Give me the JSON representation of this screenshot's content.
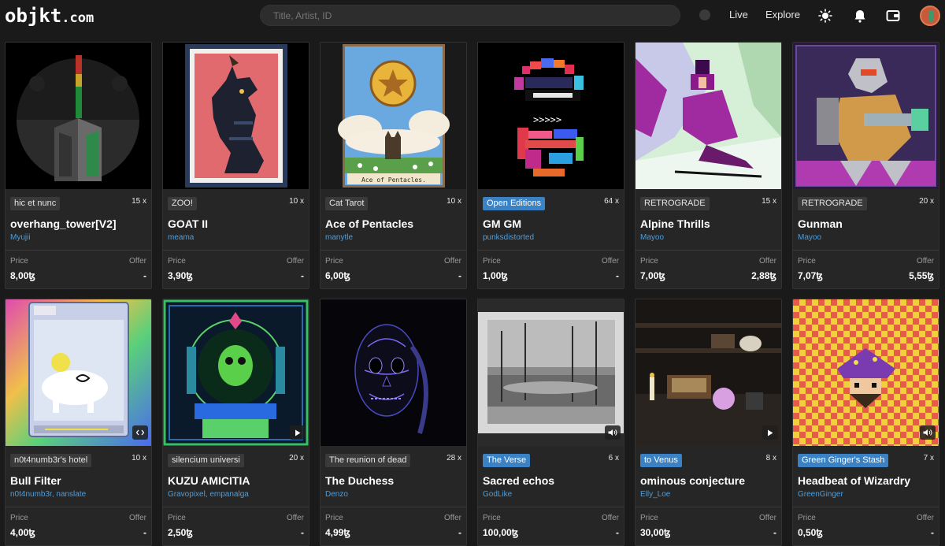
{
  "header": {
    "logo_main": "objkt",
    "logo_dom": ".com",
    "search_placeholder": "Title, Artist, ID",
    "nav_live": "Live",
    "nav_explore": "Explore",
    "icons": [
      "theme-sun-icon",
      "bell-icon",
      "wallet-icon",
      "avatar"
    ]
  },
  "labels": {
    "price": "Price",
    "offer": "Offer"
  },
  "colors": {
    "accent_blue": "#3b82c4",
    "artist_link": "#4a9fe0",
    "background": "#1a1a1a",
    "card": "#262626"
  },
  "cards": [
    {
      "badge": "hic et nunc",
      "badge_blue": false,
      "count": "15 x",
      "title": "overhang_tower[V2]",
      "artist": "Myujii",
      "price": "8,00ꜩ",
      "offer": "-"
    },
    {
      "badge": "ZOO!",
      "badge_blue": false,
      "count": "10 x",
      "title": "GOAT II",
      "artist": "meama",
      "price": "3,90ꜩ",
      "offer": "-"
    },
    {
      "badge": "Cat Tarot",
      "badge_blue": false,
      "count": "10 x",
      "title": "Ace of Pentacles",
      "artist": "manytle",
      "price": "6,00ꜩ",
      "offer": "-"
    },
    {
      "badge": "Open Editions",
      "badge_blue": true,
      "count": "64 x",
      "title": "GM GM",
      "artist": "punksdistorted",
      "price": "1,00ꜩ",
      "offer": "-"
    },
    {
      "badge": "RETROGRADE",
      "badge_blue": false,
      "count": "15 x",
      "title": "Alpine Thrills",
      "artist": "Mayoo",
      "price": "7,00ꜩ",
      "offer": "2,88ꜩ"
    },
    {
      "badge": "RETROGRADE",
      "badge_blue": false,
      "count": "20 x",
      "title": "Gunman",
      "artist": "Mayoo",
      "price": "7,07ꜩ",
      "offer": "5,55ꜩ"
    },
    {
      "badge": "n0t4numb3r's hotel",
      "badge_blue": false,
      "count": "10 x",
      "title": "Bull Filter",
      "artist": "n0t4numb3r, nanslate",
      "price": "4,00ꜩ",
      "offer": "-",
      "media": "code-icon"
    },
    {
      "badge": "silencium universi",
      "badge_blue": false,
      "count": "20 x",
      "title": "KUZU AMICITIA",
      "artist": "Gravopixel, empanalga",
      "price": "2,50ꜩ",
      "offer": "-",
      "media": "play-icon"
    },
    {
      "badge": "The reunion of dead",
      "badge_blue": false,
      "count": "28 x",
      "title": "The Duchess",
      "artist": "Denzo",
      "price": "4,99ꜩ",
      "offer": "-"
    },
    {
      "badge": "The Verse",
      "badge_blue": true,
      "count": "6 x",
      "title": "Sacred echos",
      "artist": "GodLike",
      "price": "100,00ꜩ",
      "offer": "-",
      "media": "audio-icon"
    },
    {
      "badge": "to Venus",
      "badge_blue": true,
      "count": "8 x",
      "title": "ominous conjecture",
      "artist": "Elly_Loe",
      "price": "30,00ꜩ",
      "offer": "-",
      "media": "play-icon"
    },
    {
      "badge": "Green Ginger's Stash",
      "badge_blue": true,
      "count": "7 x",
      "title": "Headbeat of Wizardry",
      "artist": "GreenGinger",
      "price": "0,50ꜩ",
      "offer": "-",
      "media": "audio-icon"
    }
  ]
}
